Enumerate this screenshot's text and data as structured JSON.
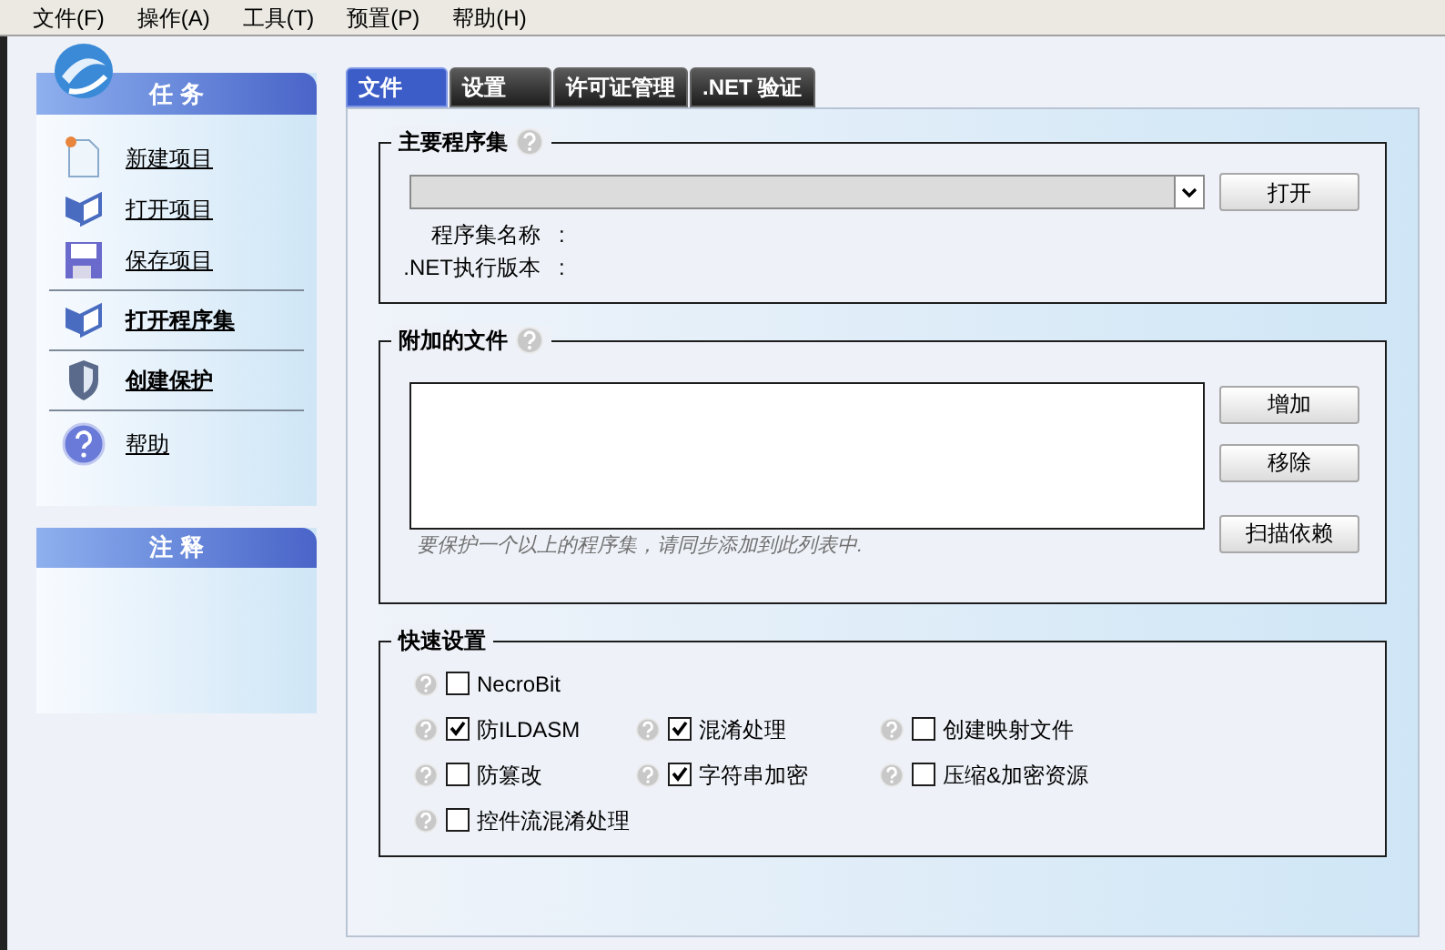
{
  "menu": [
    {
      "label": "文件(F)"
    },
    {
      "label": "操作(A)"
    },
    {
      "label": "工具(T)"
    },
    {
      "label": "预置(P)"
    },
    {
      "label": "帮助(H)"
    }
  ],
  "sidebar": {
    "tasks_title": "任 务",
    "groups": [
      [
        {
          "label": "新建项目",
          "kind": "new",
          "bold": false
        },
        {
          "label": "打开项目",
          "kind": "open",
          "bold": false
        },
        {
          "label": "保存项目",
          "kind": "save",
          "bold": false
        }
      ],
      [
        {
          "label": "打开程序集",
          "kind": "open",
          "bold": true
        }
      ],
      [
        {
          "label": "创建保护",
          "kind": "shield",
          "bold": true
        }
      ],
      [
        {
          "label": "帮助",
          "kind": "help",
          "bold": false
        }
      ]
    ],
    "notes_title": "注 释"
  },
  "tabs": [
    {
      "label": "文件",
      "selected": true
    },
    {
      "label": "设置",
      "selected": false
    },
    {
      "label": "许可证管理",
      "selected": false
    },
    {
      "label": ".NET 验证",
      "selected": false
    }
  ],
  "main_assembly": {
    "title": "主要程序集",
    "open_button": "打开",
    "fields": [
      {
        "label": "程序集名称",
        "sep": ":"
      },
      {
        "label": ".NET执行版本",
        "sep": ":"
      }
    ]
  },
  "attached_files": {
    "title": "附加的文件",
    "buttons": [
      "增加",
      "移除",
      "扫描依赖"
    ],
    "hint": "要保护一个以上的程序集，请同步添加到此列表中."
  },
  "quick_settings": {
    "title": "快速设置",
    "rows": [
      [
        {
          "label": "NecroBit",
          "checked": false
        }
      ],
      [
        {
          "label": "防ILDASM",
          "checked": true
        },
        {
          "label": "混淆处理",
          "checked": true
        },
        {
          "label": "创建映射文件",
          "checked": false
        }
      ],
      [
        {
          "label": "防篡改",
          "checked": false
        },
        {
          "label": "字符串加密",
          "checked": true
        },
        {
          "label": "压缩&加密资源",
          "checked": false
        }
      ],
      [
        {
          "label": "控件流混淆处理",
          "checked": false
        }
      ]
    ]
  }
}
